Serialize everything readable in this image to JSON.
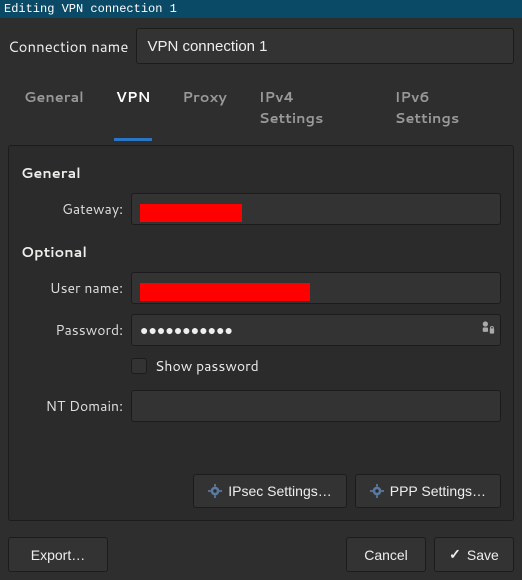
{
  "title": "Editing VPN connection 1",
  "connection": {
    "name_label": "Connection name",
    "name_value": "VPN connection 1"
  },
  "tabs": {
    "general": "General",
    "vpn": "VPN",
    "proxy": "Proxy",
    "ipv4": "IPv4 Settings",
    "ipv6": "IPv6 Settings"
  },
  "sections": {
    "general": "General",
    "optional": "Optional"
  },
  "labels": {
    "gateway": "Gateway:",
    "username": "User name:",
    "password": "Password:",
    "show_password": "Show password",
    "nt_domain": "NT Domain:"
  },
  "values": {
    "password_masked": "●●●●●●●●●●●",
    "nt_domain": ""
  },
  "buttons": {
    "ipsec": "IPsec Settings…",
    "ppp": "PPP Settings…",
    "export": "Export…",
    "cancel": "Cancel",
    "save": "Save"
  },
  "icons": {
    "password_store": "password-store-icon",
    "gear": "gear-icon",
    "check": "✓"
  }
}
